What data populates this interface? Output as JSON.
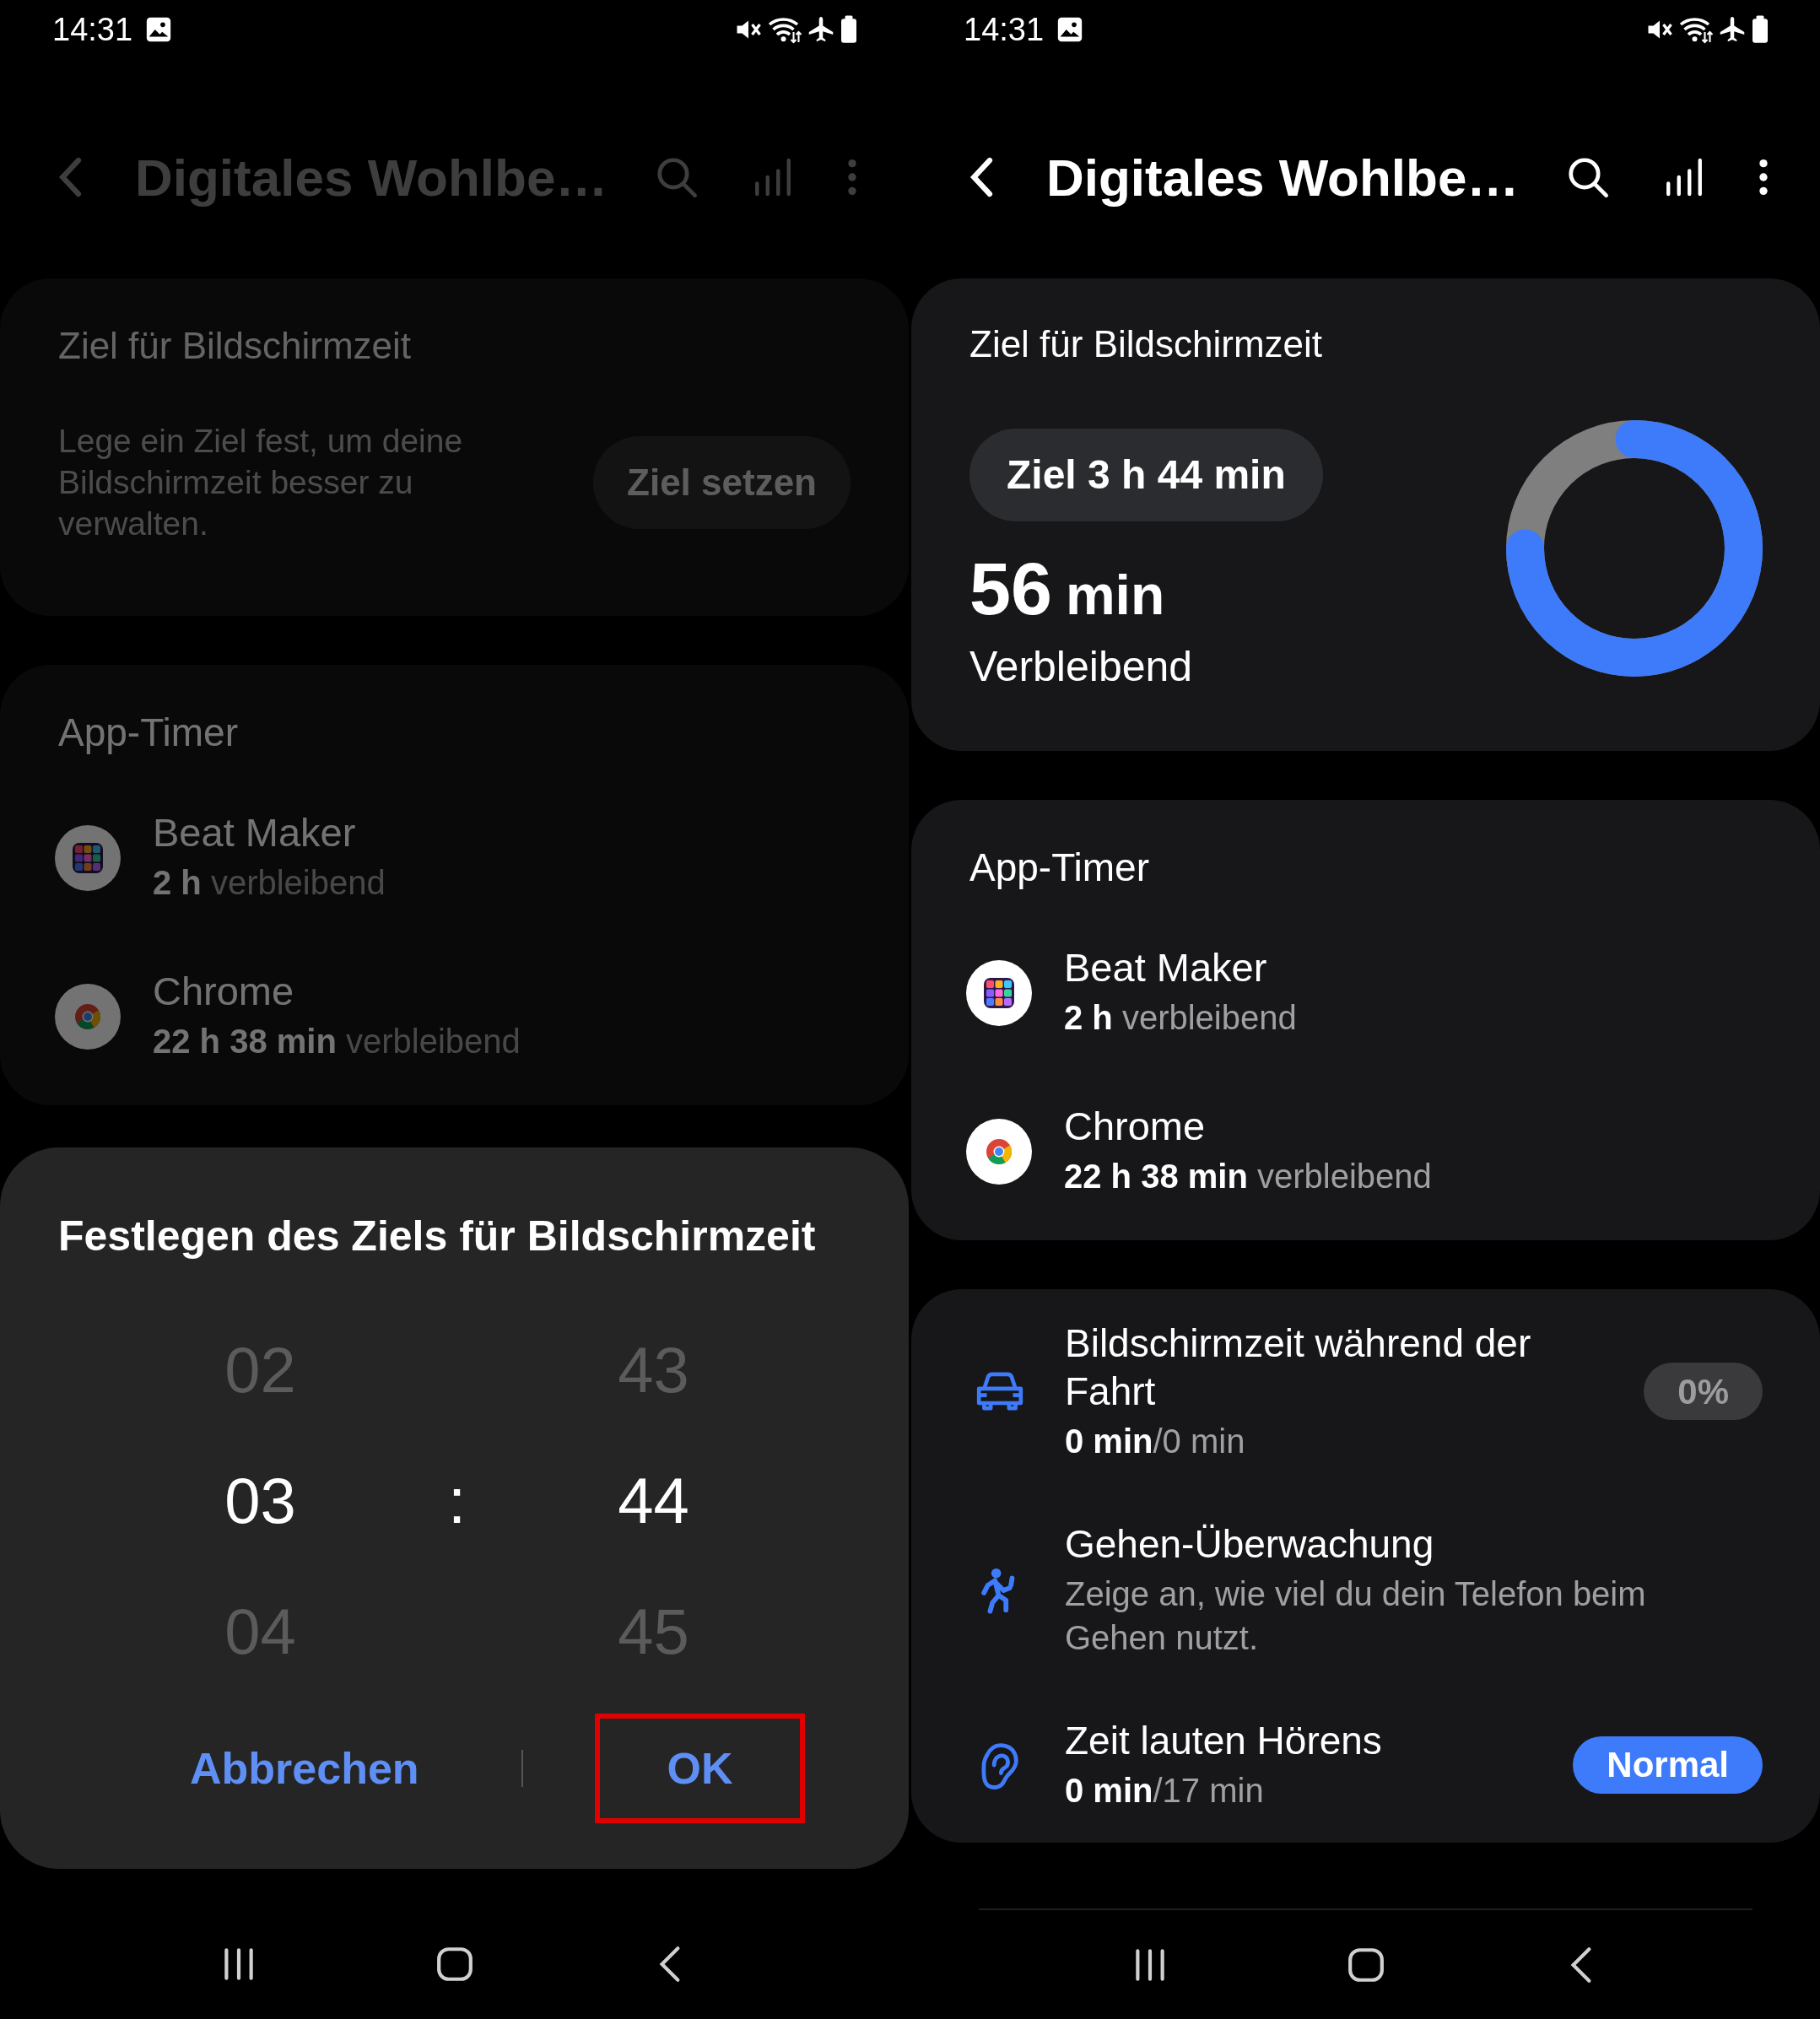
{
  "screens": [
    {
      "dimmed": true,
      "status_bar": {
        "time": "14:31"
      },
      "header": {
        "title": "Digitales Wohlbe…"
      },
      "goal_card": {
        "kind": "empty",
        "title": "Ziel für Bildschirmzeit",
        "description": "Lege ein Ziel fest, um deine Bildschirmzeit besser zu verwalten.",
        "button": "Ziel setzen"
      },
      "timer_card": {
        "title": "App-Timer",
        "apps": [
          {
            "name": "Beat Maker",
            "remaining": "**2 h** verbleibend"
          },
          {
            "name": "Chrome",
            "remaining": "**22 h 38 min** verbleibend"
          }
        ]
      },
      "dialog": {
        "title": "Festlegen des Ziels für Bildschirmzeit",
        "hours": [
          {
            "text": "02",
            "selected": false
          },
          {
            "text": "03",
            "selected": true
          },
          {
            "text": "04",
            "selected": false
          }
        ],
        "separator": ":",
        "minutes": [
          {
            "text": "43",
            "selected": false
          },
          {
            "text": "44",
            "selected": true
          },
          {
            "text": "45",
            "selected": false
          }
        ],
        "buttons": [
          {
            "label": "Abbrechen",
            "highlighted": false
          },
          {
            "label": "OK",
            "highlighted": true
          }
        ]
      }
    },
    {
      "dimmed": false,
      "status_bar": {
        "time": "14:31"
      },
      "header": {
        "title": "Digitales Wohlbe…"
      },
      "goal_card": {
        "kind": "set",
        "title": "Ziel für Bildschirmzeit",
        "chip": "Ziel 3 h 44 min",
        "remaining_value": "56",
        "remaining_unit": "min",
        "remaining_label": "Verbleibend",
        "level": 0.75
      },
      "timer_card": {
        "title": "App-Timer",
        "apps": [
          {
            "name": "Beat Maker",
            "remaining": "**2 h** verbleibend"
          },
          {
            "name": "Chrome",
            "remaining": "**22 h 38 min** verbleibend"
          }
        ]
      },
      "feature_card": {
        "rows": [
          {
            "title": "Bildschirmzeit während der Fahrt",
            "subtitle": "**0 min**/0 min",
            "badge": {
              "text": "0%",
              "kind": "neutral"
            }
          },
          {
            "title": "Gehen-Überwachung",
            "subtitle": "Zeige an, wie viel du dein Telefon beim Gehen nutzt."
          },
          {
            "title": "Zeit lauten Hörens",
            "subtitle": "**0 min**/17 min",
            "badge": {
              "text": "Normal",
              "kind": "accent"
            }
          }
        ]
      }
    }
  ]
}
